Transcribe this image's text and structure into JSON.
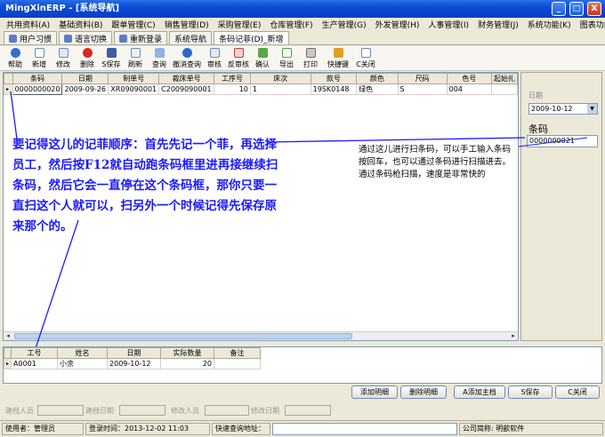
{
  "window": {
    "title": "MingXinERP - [系统导航]",
    "minimize": "_",
    "maximize": "□",
    "close": "X"
  },
  "menu": [
    "共用资料(A)",
    "基础资料(B)",
    "跟单管理(C)",
    "销售管理(D)",
    "采购管理(E)",
    "仓库管理(F)",
    "生产管理(G)",
    "外发管理(H)",
    "人事管理(I)",
    "财务管理(J)",
    "系统功能(K)",
    "图表功能"
  ],
  "tabs": [
    "用户习惯",
    "语言切换",
    "重新登录",
    "系统导航",
    "条码记菲(D)_新增"
  ],
  "toolbar": [
    "帮助",
    "新增",
    "修改",
    "删除",
    "S保存",
    "刷新",
    "查询",
    "撤消查询",
    "审核",
    "反审核",
    "确认",
    "导出",
    "打印",
    "快捷键",
    "C关闭"
  ],
  "grid": {
    "columns": [
      "条码",
      "日期",
      "制单号",
      "裁床单号",
      "工序号",
      "床次",
      "款号",
      "颜色",
      "尺码",
      "色号",
      "起始扎"
    ],
    "rows": [
      [
        "0000000020",
        "2009-09-26",
        "XR09090001",
        "C2009090001",
        "10",
        "1",
        "19SK0148",
        "绿色",
        "S",
        "004",
        ""
      ]
    ]
  },
  "right_panel": {
    "date_label": "日期",
    "date_value": "2009-10-12",
    "barcode_label": "条码",
    "barcode_value": "0000000021"
  },
  "lower_grid": {
    "columns": [
      "工号",
      "姓名",
      "日期",
      "实际数量",
      "备注"
    ],
    "rows": [
      [
        "A0001",
        "小余",
        "2009-10-12",
        "20",
        ""
      ]
    ]
  },
  "buttons": {
    "add_detail": "添加明细",
    "delete_detail": "删除明细",
    "add_master": "A添加主档",
    "save": "S保存",
    "close": "C关闭"
  },
  "audit": {
    "creator": "建档人员",
    "create_date": "建档日期",
    "modifier": "修改人员",
    "modify_date": "修改日期"
  },
  "status": {
    "user": "使用者：管理员",
    "login": "登录时间：2013-12-02 11:03",
    "quick_query": "快速查询地址：",
    "company": "公司简称: 明歆软件"
  },
  "annotations": {
    "main_note": "要记得这儿的记菲顺序：首先先记一个菲，再选择员工，然后按F12就自动跑条码框里进再接继续扫条码，然后它会一直停在这个条码框，那你只要一直扫这个人就可以，扫另外一个时候记得先保存原来那个的。",
    "side_note": "通过这儿进行扫条码，可以手工输入条码按回车，也可以通过条码进行扫描进去。通过条码枪扫描，速度是非常快的"
  },
  "colors": {
    "annotation_blue": "#1a1aff",
    "titlebar": "#0a4bd6"
  }
}
